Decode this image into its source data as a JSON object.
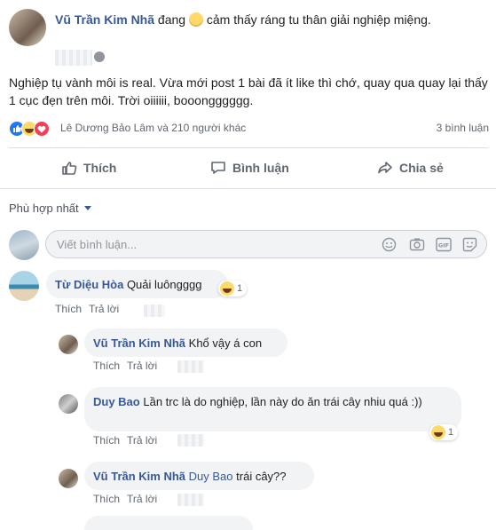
{
  "post": {
    "author": "Vũ Trần Kim Nhã",
    "status_verb": "đang",
    "feeling": "cảm thấy ráng tu thân giải nghiệp miệng.",
    "text": "Nghiệp tụ vành môi is real. Vừa mới post 1 bài đã ít like thì chớ, quay qua quay lại thấy 1 cục đẹn trên môi. Trời oiiiiii, booongggggg.",
    "reactors": "Lê Dương Bảo Lâm và 210 người khác",
    "comment_count": "3 bình luận"
  },
  "actions": {
    "like": "Thích",
    "comment": "Bình luận",
    "share": "Chia sẻ"
  },
  "sort_label": "Phù hợp nhất",
  "comment_input": {
    "placeholder": "Viết bình luận..."
  },
  "comments": [
    {
      "name": "Từ Diệu Hòa",
      "text": "Quải luôngggg",
      "reaction_count": "1",
      "like": "Thích",
      "reply": "Trả lời"
    },
    {
      "name": "Vũ Trần Kim Nhã",
      "text": "Khổ vậy á con",
      "like": "Thích",
      "reply": "Trả lời"
    },
    {
      "name": "Duy Bao",
      "text": "Lần trc là do nghiệp, lần này do ăn trái cây nhiu quá :))",
      "reaction_count": "1",
      "like": "Thích",
      "reply": "Trả lời"
    },
    {
      "name": "Vũ Trần Kim Nhã",
      "mention": "Duy Bao",
      "text": "trái cây??",
      "like": "Thích",
      "reply": "Trả lời"
    }
  ],
  "colors": {
    "link_blue": "#385898",
    "like_blue": "#2078f4",
    "love_red": "#f33e58",
    "haha_yellow": "#ffd96a",
    "bubble_bg": "#f2f3f5"
  }
}
